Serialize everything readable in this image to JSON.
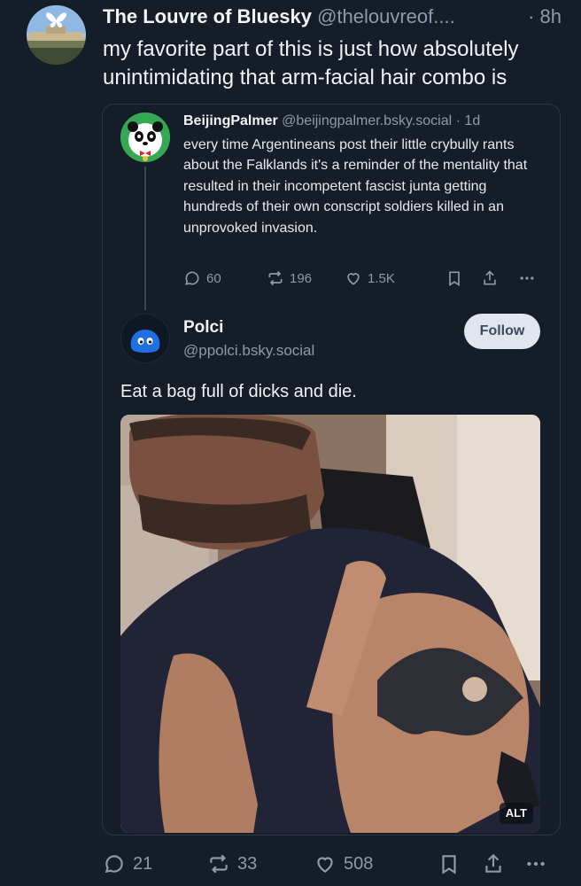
{
  "post": {
    "author_name": "The Louvre of Bluesky",
    "author_handle": "@thelouvreof....",
    "time": "· 8h",
    "text": "my favorite part of this is just how absolutely unintimidating that arm-facial hair combo is",
    "actions": {
      "replies": "21",
      "reposts": "33",
      "likes": "508"
    }
  },
  "quote": {
    "author_name": "BeijingPalmer",
    "author_handle": "@beijingpalmer.bsky.social",
    "time": "· 1d",
    "text": "every time Argentineans post their little crybully rants about the Falklands it's a reminder of the mentality that resulted in their incompetent fascist junta getting hundreds of their own conscript soldiers killed in an unprovoked invasion.",
    "actions": {
      "replies": "60",
      "reposts": "196",
      "likes": "1.5K"
    }
  },
  "reply": {
    "author_name": "Polci",
    "author_handle": "@ppolci.bsky.social",
    "follow_label": "Follow",
    "text": "Eat a bag full of dicks and die.",
    "alt_label": "ALT"
  },
  "colors": {
    "background": "#151d28",
    "text": "#f1f3f5",
    "muted": "#8c9aac",
    "border": "#2b3645",
    "follow_button_bg": "#dfe6ee"
  },
  "icons": [
    "butterfly-icon",
    "reply-icon",
    "repost-icon",
    "like-icon",
    "bookmark-icon",
    "share-icon",
    "more-icon"
  ]
}
